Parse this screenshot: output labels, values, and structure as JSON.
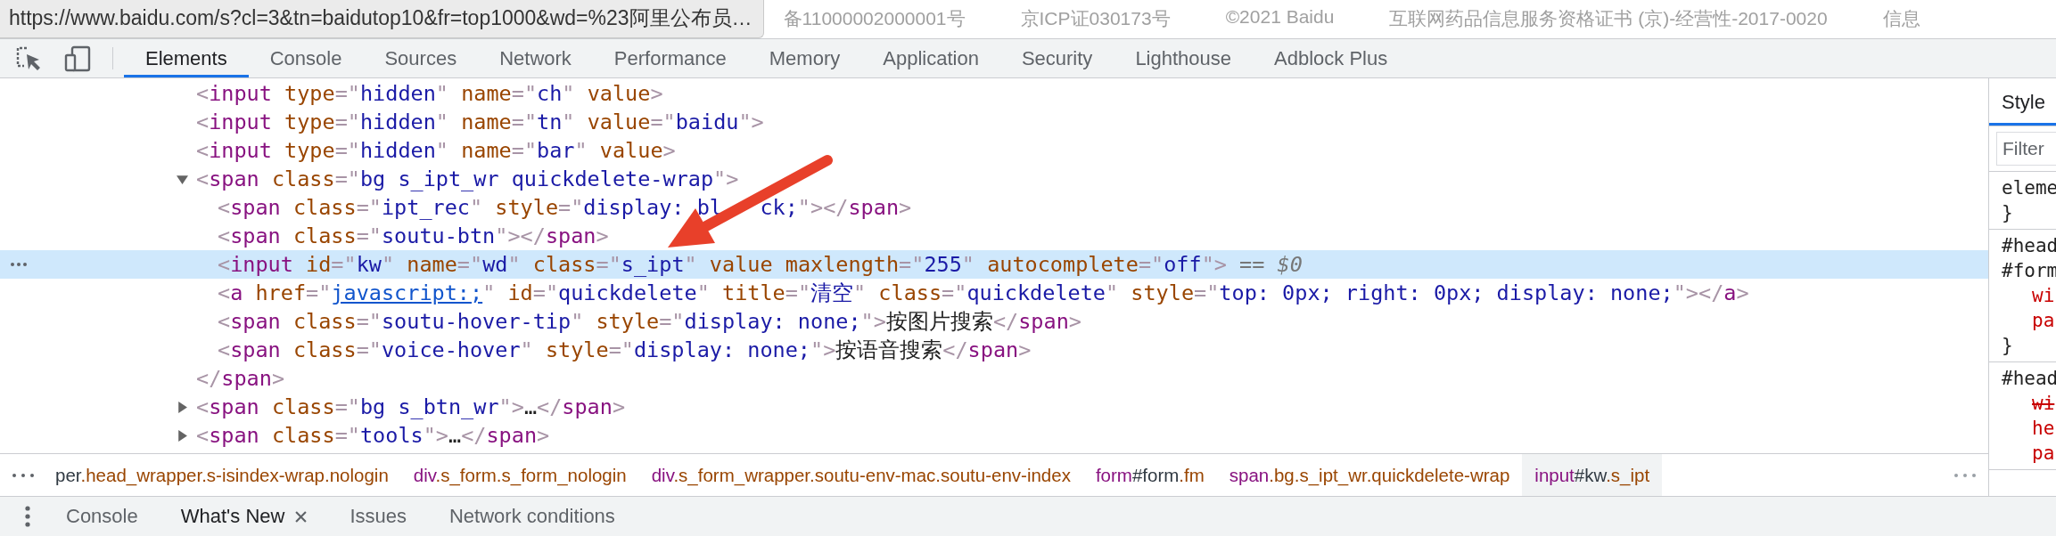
{
  "url_tooltip": "https://www.baidu.com/s?cl=3&tn=baidutop10&fr=top1000&wd=%23阿里公布员…",
  "page_footer": [
    "备11000002000001号",
    "京ICP证030173号",
    "©2021 Baidu",
    "互联网药品信息服务资格证书 (京)-经营性-2017-0020",
    "信息"
  ],
  "devtools_tabs": [
    {
      "label": "Elements",
      "selected": true
    },
    {
      "label": "Console",
      "selected": false
    },
    {
      "label": "Sources",
      "selected": false
    },
    {
      "label": "Network",
      "selected": false
    },
    {
      "label": "Performance",
      "selected": false
    },
    {
      "label": "Memory",
      "selected": false
    },
    {
      "label": "Application",
      "selected": false
    },
    {
      "label": "Security",
      "selected": false
    },
    {
      "label": "Lighthouse",
      "selected": false
    },
    {
      "label": "Adblock Plus",
      "selected": false
    }
  ],
  "code_rows": [
    {
      "selected": false,
      "tokens": [
        {
          "kind": "punct",
          "text": "<"
        },
        {
          "kind": "tag",
          "text": "input"
        },
        {
          "kind": "attr",
          "text": " type"
        },
        {
          "kind": "punct",
          "text": "=\""
        },
        {
          "kind": "value",
          "text": "hidden"
        },
        {
          "kind": "punct",
          "text": "\""
        },
        {
          "kind": "attr",
          "text": " name"
        },
        {
          "kind": "punct",
          "text": "=\""
        },
        {
          "kind": "value",
          "text": "ch"
        },
        {
          "kind": "punct",
          "text": "\""
        },
        {
          "kind": "attr",
          "text": " value"
        },
        {
          "kind": "punct",
          "text": ">"
        }
      ]
    },
    {
      "selected": false,
      "tokens": [
        {
          "kind": "punct",
          "text": "<"
        },
        {
          "kind": "tag",
          "text": "input"
        },
        {
          "kind": "attr",
          "text": " type"
        },
        {
          "kind": "punct",
          "text": "=\""
        },
        {
          "kind": "value",
          "text": "hidden"
        },
        {
          "kind": "punct",
          "text": "\""
        },
        {
          "kind": "attr",
          "text": " name"
        },
        {
          "kind": "punct",
          "text": "=\""
        },
        {
          "kind": "value",
          "text": "tn"
        },
        {
          "kind": "punct",
          "text": "\""
        },
        {
          "kind": "attr",
          "text": " value"
        },
        {
          "kind": "punct",
          "text": "=\""
        },
        {
          "kind": "value",
          "text": "baidu"
        },
        {
          "kind": "punct",
          "text": "\">"
        }
      ]
    },
    {
      "selected": false,
      "tokens": [
        {
          "kind": "punct",
          "text": "<"
        },
        {
          "kind": "tag",
          "text": "input"
        },
        {
          "kind": "attr",
          "text": " type"
        },
        {
          "kind": "punct",
          "text": "=\""
        },
        {
          "kind": "value",
          "text": "hidden"
        },
        {
          "kind": "punct",
          "text": "\""
        },
        {
          "kind": "attr",
          "text": " name"
        },
        {
          "kind": "punct",
          "text": "=\""
        },
        {
          "kind": "value",
          "text": "bar"
        },
        {
          "kind": "punct",
          "text": "\""
        },
        {
          "kind": "attr",
          "text": " value"
        },
        {
          "kind": "punct",
          "text": ">"
        }
      ]
    },
    {
      "selected": false,
      "expanded": true,
      "tokens": [
        {
          "kind": "punct",
          "text": "<"
        },
        {
          "kind": "tag",
          "text": "span"
        },
        {
          "kind": "attr",
          "text": " class"
        },
        {
          "kind": "punct",
          "text": "=\""
        },
        {
          "kind": "value",
          "text": "bg s_ipt_wr quickdelete-wrap"
        },
        {
          "kind": "punct",
          "text": "\">"
        }
      ],
      "children": [
        {
          "selected": false,
          "tokens": [
            {
              "kind": "punct",
              "text": "<"
            },
            {
              "kind": "tag",
              "text": "span"
            },
            {
              "kind": "attr",
              "text": " class"
            },
            {
              "kind": "punct",
              "text": "=\""
            },
            {
              "kind": "value",
              "text": "ipt_rec"
            },
            {
              "kind": "punct",
              "text": "\""
            },
            {
              "kind": "attr",
              "text": " style"
            },
            {
              "kind": "punct",
              "text": "=\""
            },
            {
              "kind": "value",
              "text": "display: bl",
              "gap_after": true
            },
            {
              "kind": "value",
              "text": "ck;",
              "gap_after": false
            },
            {
              "kind": "punct",
              "text": "\"></"
            },
            {
              "kind": "tag",
              "text": "span"
            },
            {
              "kind": "punct",
              "text": ">"
            }
          ]
        },
        {
          "selected": false,
          "tokens": [
            {
              "kind": "punct",
              "text": "<"
            },
            {
              "kind": "tag",
              "text": "span"
            },
            {
              "kind": "attr",
              "text": " class"
            },
            {
              "kind": "punct",
              "text": "=\""
            },
            {
              "kind": "value",
              "text": "soutu-btn"
            },
            {
              "kind": "punct",
              "text": "\"></"
            },
            {
              "kind": "tag",
              "text": "span"
            },
            {
              "kind": "punct",
              "text": ">"
            }
          ]
        },
        {
          "selected": true,
          "tokens": [
            {
              "kind": "punct",
              "text": "<"
            },
            {
              "kind": "tag",
              "text": "input"
            },
            {
              "kind": "attr",
              "text": " id"
            },
            {
              "kind": "punct",
              "text": "=\""
            },
            {
              "kind": "value",
              "text": "kw"
            },
            {
              "kind": "punct",
              "text": "\""
            },
            {
              "kind": "attr",
              "text": " name"
            },
            {
              "kind": "punct",
              "text": "=\""
            },
            {
              "kind": "value",
              "text": "wd"
            },
            {
              "kind": "punct",
              "text": "\""
            },
            {
              "kind": "attr",
              "text": " class"
            },
            {
              "kind": "punct",
              "text": "=\""
            },
            {
              "kind": "value",
              "text": "s_ipt"
            },
            {
              "kind": "punct",
              "text": "\""
            },
            {
              "kind": "attr",
              "text": " value"
            },
            {
              "kind": "attr",
              "text": " maxlength"
            },
            {
              "kind": "punct",
              "text": "=\""
            },
            {
              "kind": "value",
              "text": "255"
            },
            {
              "kind": "punct",
              "text": "\""
            },
            {
              "kind": "attr",
              "text": " autocomplete"
            },
            {
              "kind": "punct",
              "text": "=\""
            },
            {
              "kind": "value",
              "text": "off"
            },
            {
              "kind": "punct",
              "text": "\">"
            },
            {
              "kind": "eq",
              "text": " == "
            },
            {
              "kind": "ref",
              "text": "$0"
            }
          ]
        },
        {
          "selected": false,
          "tokens": [
            {
              "kind": "punct",
              "text": "<"
            },
            {
              "kind": "tag",
              "text": "a"
            },
            {
              "kind": "attr",
              "text": " href"
            },
            {
              "kind": "punct",
              "text": "=\""
            },
            {
              "kind": "link",
              "text": "javascript:;"
            },
            {
              "kind": "punct",
              "text": "\""
            },
            {
              "kind": "attr",
              "text": " id"
            },
            {
              "kind": "punct",
              "text": "=\""
            },
            {
              "kind": "value",
              "text": "quickdelete"
            },
            {
              "kind": "punct",
              "text": "\""
            },
            {
              "kind": "attr",
              "text": " title"
            },
            {
              "kind": "punct",
              "text": "=\""
            },
            {
              "kind": "value",
              "text": "清空"
            },
            {
              "kind": "punct",
              "text": "\""
            },
            {
              "kind": "attr",
              "text": " class"
            },
            {
              "kind": "punct",
              "text": "=\""
            },
            {
              "kind": "value",
              "text": "quickdelete"
            },
            {
              "kind": "punct",
              "text": "\""
            },
            {
              "kind": "attr",
              "text": " style"
            },
            {
              "kind": "punct",
              "text": "=\""
            },
            {
              "kind": "value",
              "text": "top: 0px; right: 0px; display: none;"
            },
            {
              "kind": "punct",
              "text": "\"></"
            },
            {
              "kind": "tag",
              "text": "a"
            },
            {
              "kind": "punct",
              "text": ">"
            }
          ]
        },
        {
          "selected": false,
          "tokens": [
            {
              "kind": "punct",
              "text": "<"
            },
            {
              "kind": "tag",
              "text": "span"
            },
            {
              "kind": "attr",
              "text": " class"
            },
            {
              "kind": "punct",
              "text": "=\""
            },
            {
              "kind": "value",
              "text": "soutu-hover-tip"
            },
            {
              "kind": "punct",
              "text": "\""
            },
            {
              "kind": "attr",
              "text": " style"
            },
            {
              "kind": "punct",
              "text": "=\""
            },
            {
              "kind": "value",
              "text": "display: none;"
            },
            {
              "kind": "punct",
              "text": "\">"
            },
            {
              "kind": "text",
              "text": "按图片搜索"
            },
            {
              "kind": "punct",
              "text": "</"
            },
            {
              "kind": "tag",
              "text": "span"
            },
            {
              "kind": "punct",
              "text": ">"
            }
          ]
        },
        {
          "selected": false,
          "tokens": [
            {
              "kind": "punct",
              "text": "<"
            },
            {
              "kind": "tag",
              "text": "span"
            },
            {
              "kind": "attr",
              "text": " class"
            },
            {
              "kind": "punct",
              "text": "=\""
            },
            {
              "kind": "value",
              "text": "voice-hover"
            },
            {
              "kind": "punct",
              "text": "\""
            },
            {
              "kind": "attr",
              "text": " style"
            },
            {
              "kind": "punct",
              "text": "=\""
            },
            {
              "kind": "value",
              "text": "display: none;"
            },
            {
              "kind": "punct",
              "text": "\">"
            },
            {
              "kind": "text",
              "text": "按语音搜索"
            },
            {
              "kind": "punct",
              "text": "</"
            },
            {
              "kind": "tag",
              "text": "span"
            },
            {
              "kind": "punct",
              "text": ">"
            }
          ]
        }
      ],
      "end_tokens": [
        {
          "kind": "punct",
          "text": "</"
        },
        {
          "kind": "tag",
          "text": "span"
        },
        {
          "kind": "punct",
          "text": ">"
        }
      ]
    },
    {
      "selected": false,
      "expanded": false,
      "tokens": [
        {
          "kind": "punct",
          "text": "<"
        },
        {
          "kind": "tag",
          "text": "span"
        },
        {
          "kind": "attr",
          "text": " class"
        },
        {
          "kind": "punct",
          "text": "=\""
        },
        {
          "kind": "value",
          "text": "bg s_btn_wr"
        },
        {
          "kind": "punct",
          "text": "\">"
        },
        {
          "kind": "text",
          "text": "…"
        },
        {
          "kind": "punct",
          "text": "</"
        },
        {
          "kind": "tag",
          "text": "span"
        },
        {
          "kind": "punct",
          "text": ">"
        }
      ]
    },
    {
      "selected": false,
      "expanded": false,
      "tokens": [
        {
          "kind": "punct",
          "text": "<"
        },
        {
          "kind": "tag",
          "text": "span"
        },
        {
          "kind": "attr",
          "text": " class"
        },
        {
          "kind": "punct",
          "text": "=\""
        },
        {
          "kind": "value",
          "text": "tools"
        },
        {
          "kind": "punct",
          "text": "\">"
        },
        {
          "kind": "text",
          "text": "…"
        },
        {
          "kind": "punct",
          "text": "</"
        },
        {
          "kind": "tag",
          "text": "span"
        },
        {
          "kind": "punct",
          "text": ">"
        }
      ]
    }
  ],
  "breadcrumbs": [
    {
      "selected": false,
      "tokens": [
        {
          "kind": "id",
          "text": "per"
        },
        {
          "kind": "class",
          "text": ".head_wrapper.s-isindex-wrap.nologin"
        }
      ]
    },
    {
      "selected": false,
      "tokens": [
        {
          "kind": "tag",
          "text": "div"
        },
        {
          "kind": "class",
          "text": ".s_form.s_form_nologin"
        }
      ]
    },
    {
      "selected": false,
      "tokens": [
        {
          "kind": "tag",
          "text": "div"
        },
        {
          "kind": "class",
          "text": ".s_form_wrapper.soutu-env-mac.soutu-env-index"
        }
      ]
    },
    {
      "selected": false,
      "tokens": [
        {
          "kind": "tag",
          "text": "form"
        },
        {
          "kind": "id",
          "text": "#form"
        },
        {
          "kind": "class",
          "text": ".fm"
        }
      ]
    },
    {
      "selected": false,
      "tokens": [
        {
          "kind": "tag",
          "text": "span"
        },
        {
          "kind": "class",
          "text": ".bg.s_ipt_wr.quickdelete-wrap"
        }
      ]
    },
    {
      "selected": true,
      "tokens": [
        {
          "kind": "tag",
          "text": "input"
        },
        {
          "kind": "id",
          "text": "#kw"
        },
        {
          "kind": "class",
          "text": ".s_ipt"
        }
      ]
    }
  ],
  "styles_panel": {
    "tabs": [
      {
        "label": "Style",
        "selected": true
      }
    ],
    "filter": {
      "placeholder": "Filter"
    },
    "rules": [
      {
        "lines": [
          {
            "kind": "selector",
            "text": "eleme",
            "struck": false
          },
          {
            "kind": "brace",
            "text": "}",
            "struck": false
          }
        ]
      },
      {
        "lines": [
          {
            "kind": "selector",
            "text": "#head",
            "struck": false
          },
          {
            "kind": "selector",
            "text": "#form",
            "struck": false
          },
          {
            "kind": "property",
            "text": "wi",
            "struck": false
          },
          {
            "kind": "property",
            "text": "pa",
            "struck": false
          },
          {
            "kind": "brace",
            "text": "}",
            "struck": false
          }
        ]
      },
      {
        "lines": [
          {
            "kind": "selector",
            "text": "#head",
            "struck": false
          },
          {
            "kind": "property",
            "text": "wi",
            "struck": true
          },
          {
            "kind": "property",
            "text": "he",
            "struck": false
          },
          {
            "kind": "property",
            "text": "pa",
            "struck": false
          }
        ]
      }
    ]
  },
  "drawer_tabs": [
    {
      "label": "Console",
      "selected": false,
      "closable": false
    },
    {
      "label": "What's New",
      "selected": true,
      "closable": true
    },
    {
      "label": "Issues",
      "selected": false,
      "closable": false
    },
    {
      "label": "Network conditions",
      "selected": false,
      "closable": false
    }
  ]
}
